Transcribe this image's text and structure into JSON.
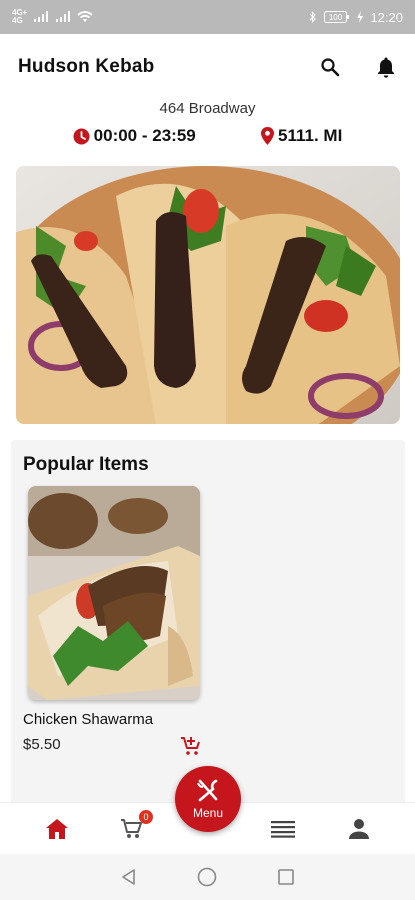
{
  "status_bar": {
    "network_top": "4G+",
    "network_bottom": "4G",
    "battery": "100",
    "time": "12:20"
  },
  "header": {
    "title": "Hudson Kebab",
    "search_icon": "search-icon",
    "bell_icon": "bell-icon"
  },
  "restaurant": {
    "address": "464 Broadway",
    "hours": "00:00 - 23:59",
    "distance": "5111. MI"
  },
  "hero": {
    "image": "kebab-pitas-photo"
  },
  "popular": {
    "title": "Popular Items",
    "items": [
      {
        "name": "Chicken Shawarma",
        "price": "$5.50",
        "image": "chicken-shawarma-photo"
      }
    ]
  },
  "bottom_nav": {
    "cart_count": "0",
    "menu_label": "Menu",
    "icons": [
      "home-icon",
      "cart-icon",
      "fork-knife-icon",
      "list-icon",
      "person-icon"
    ]
  },
  "colors": {
    "accent": "#c4161c",
    "badge": "#e0311e"
  }
}
